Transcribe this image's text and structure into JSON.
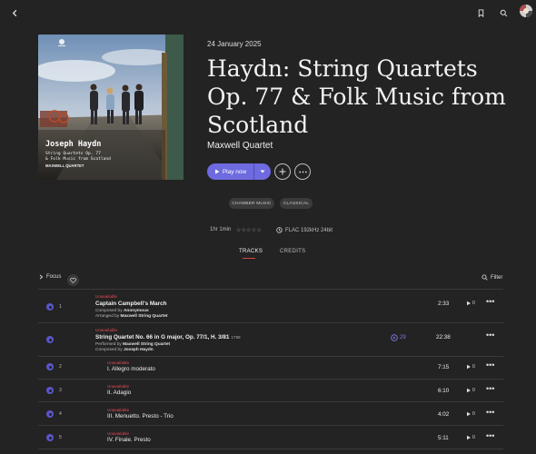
{
  "album": {
    "date": "24 January 2025",
    "title": "Haydn: String Quartets Op. 77 & Folk Music from Scotland",
    "artist": "Maxwell Quartet",
    "cover": {
      "composer": "Joseph Haydn",
      "subtitle_line1": "String Quartets Op. 77",
      "subtitle_line2": "& Folk Music from Scotland",
      "performer": "MAXWELL QUARTET"
    }
  },
  "actions": {
    "play_label": "Play now"
  },
  "tags": [
    "CHAMBER MUSIC",
    "CLASSICAL"
  ],
  "meta": {
    "duration": "1hr 1min",
    "rating": "☆☆☆☆☆",
    "quality": "FLAC 192kHz 24bit"
  },
  "tabs": {
    "tracks": "TRACKS",
    "credits": "CREDITS"
  },
  "toolbar": {
    "focus_label": "Focus",
    "filter_label": "Filter"
  },
  "tracks": [
    {
      "num": "1",
      "status": "Unavailable",
      "title": "Captain Campbell's March",
      "line1_prefix": "Composed by",
      "line1_name": "Anonymous",
      "line2_prefix": "Arranged by",
      "line2_name": "Maxwell String Quartet",
      "duration": "2:33",
      "plays": "0"
    },
    {
      "num": "",
      "status": "Unavailable",
      "title": "String Quartet No. 66 in G major, Op. 77/1, H. 3/81",
      "year": "1799",
      "line1_prefix": "Performed by",
      "line1_name": "Maxwell String Quartet",
      "line2_prefix": "Composed by",
      "line2_name": "Joseph Haydn",
      "views": "29",
      "duration": "22:38"
    },
    {
      "num": "2",
      "status": "Unavailable",
      "title": "I. Allegro moderato",
      "duration": "7:15",
      "plays": "0"
    },
    {
      "num": "3",
      "status": "Unavailable",
      "title": "II. Adagio",
      "duration": "6:10",
      "plays": "0"
    },
    {
      "num": "4",
      "status": "Unavailable",
      "title": "III. Menuetto. Presto - Trio",
      "duration": "4:02",
      "plays": "0"
    },
    {
      "num": "5",
      "status": "Unavailable",
      "title": "IV. Finale. Presto",
      "duration": "5:11",
      "plays": "0"
    }
  ],
  "colors": {
    "accent": "#6e6ae0",
    "unavailable": "#e04b55",
    "tab_underline": "#d9433b",
    "background": "#232323"
  }
}
